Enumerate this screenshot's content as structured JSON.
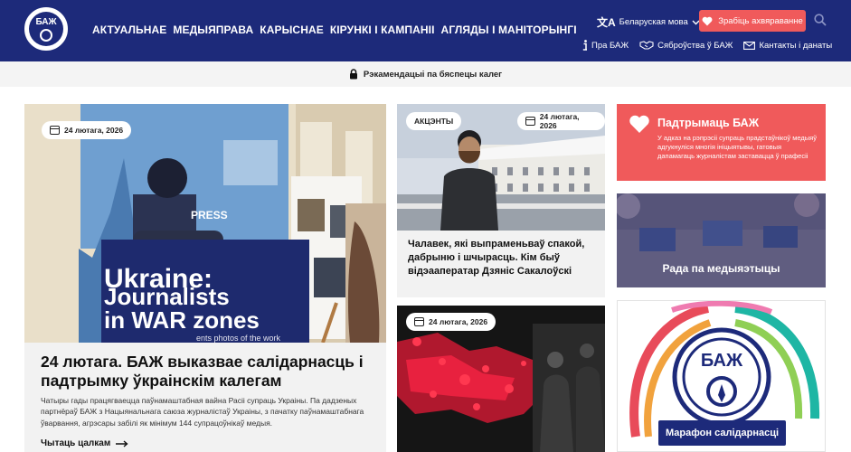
{
  "header": {
    "logo_text": "БАЖ",
    "nav": [
      "АКТУАЛЬНАЕ",
      "МЕДЫЯПРАВА",
      "КАРЫСНАЕ",
      " КІРУНКІ І КАМПАНІІ",
      "АГЛЯДЫ І МАНІТОРЫНГІ"
    ],
    "language": "Беларуская мова",
    "donate_label": "Зрабіць ахвяраванне",
    "subnav": {
      "about": "Пра БАЖ",
      "membership": "Сяброўства ў БАЖ",
      "contacts": "Кантакты і данаты"
    }
  },
  "safety_bar": {
    "text": "Рэкамендацыі па бяспецы калег"
  },
  "hero": {
    "date": "24 лютага, 2026",
    "title": "24 лютага. БАЖ выказвае салідарнасць і падтрымку ўкраінскім калегам",
    "excerpt": "Чатыры гады працягваецца паўнамаштабная вайна Расіі супраць Украіны. Па дадзеных партнёраў БАЖ з Нацыянальнага саюза журналістаў Украіны, з пачатку паўнамаштабнага ўварвання, агрэсары забілі як мінімум 144 супрацоўнікаў медыя.",
    "read_more": "Чытаць цалкам",
    "image_text": {
      "poster_line1": "Ukraine:",
      "poster_line2": "Journalists",
      "poster_line3": "in WAR zones",
      "poster_sub": "ents photos of the work",
      "vest": "PRESS"
    }
  },
  "card_accent": {
    "tag": "АКЦЭНТЫ",
    "date": "24 лютага, 2026",
    "title": "Чалавек, які выпраменьваў спакой, дабрыню і шчырасць. Кім быў відэааператар Дзяніс Сакалоўскі"
  },
  "card_map": {
    "date": "24 лютага, 2026"
  },
  "sidebar": {
    "support_title": "Падтрымаць БАЖ",
    "support_text": "У адказ на рэпрэсіі супраць прадстаўнікоў медыяў адгукнуліся многія ініцыятывы, гатовыя дапамагаць журналістам заставацца ў прафесіі",
    "council_label": "Рада па медыяэтыцы",
    "marathon_label": "Марафон салідарнасці"
  },
  "colors": {
    "header": "#1d2a7a",
    "accent": "#f05a5b",
    "background": "#f4f4f4"
  }
}
